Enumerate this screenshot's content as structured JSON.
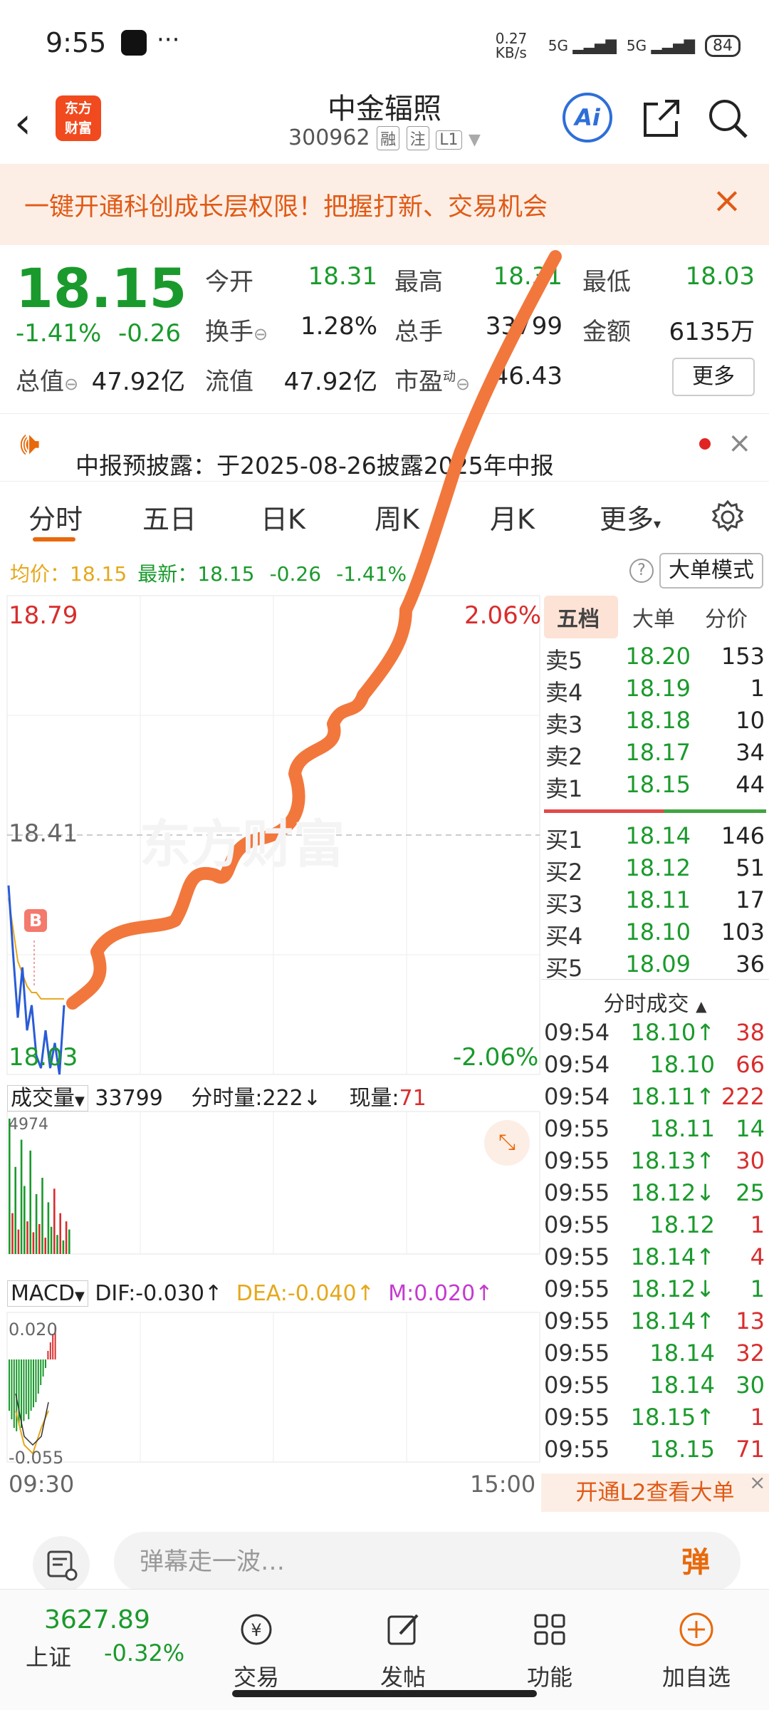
{
  "status_bar": {
    "time": "9:55",
    "speed": "0.27 KB/s",
    "net1": "5G",
    "net2": "5G",
    "battery": "84"
  },
  "header": {
    "logo_line1": "东方",
    "logo_line2": "财富",
    "name": "中金辐照",
    "code": "300962",
    "tags": [
      "融",
      "注",
      "L1"
    ]
  },
  "banner": {
    "text": "一键开通科创成长层权限！把握打新、交易机会"
  },
  "quote": {
    "price": "18.15",
    "pct": "-1.41%",
    "chg": "-0.26",
    "open_label": "今开",
    "open": "18.31",
    "high_label": "最高",
    "high": "18.31",
    "low_label": "最低",
    "low": "18.03",
    "turnover_label": "换手",
    "turnover": "1.28%",
    "volume_label": "总手",
    "volume": "33799",
    "amount_label": "金额",
    "amount": "6135万",
    "mcap_label": "总值",
    "mcap": "47.92亿",
    "float_label": "流值",
    "float": "47.92亿",
    "pe_label": "市盈",
    "pe_sup": "动",
    "pe": "46.43",
    "more": "更多"
  },
  "notice": {
    "text": "中报预披露：于2025-08-26披露2025年中报"
  },
  "tabs": [
    "分时",
    "五日",
    "日K",
    "周K",
    "月K",
    "更多"
  ],
  "avg_row": {
    "avg_label": "均价：",
    "avg": "18.15",
    "last_label": "最新：",
    "last": "18.15",
    "chg": "-0.26",
    "pct": "-1.41%",
    "big_order": "大单模式"
  },
  "chart_data": {
    "type": "line",
    "price_axis": {
      "top": "18.79",
      "mid": "18.41",
      "bottom": "18.03",
      "top_pct": "2.06%",
      "bottom_pct": "-2.06%"
    },
    "marker": "B",
    "price_line": [
      18.33,
      18.22,
      18.12,
      18.2,
      18.1,
      18.14,
      18.06,
      18.04,
      18.1,
      18.04,
      18.08,
      18.03,
      18.14
    ],
    "avg_line": [
      18.31,
      18.26,
      18.21,
      18.19,
      18.17,
      18.16,
      18.16,
      18.15,
      18.15,
      18.15,
      18.15,
      18.15,
      18.15
    ],
    "volume_header": {
      "label": "成交量",
      "value": "33799",
      "minute_label": "分时量:",
      "minute": "222",
      "now_label": "现量:",
      "now": "71"
    },
    "volume_max": "4974",
    "volume_bars": [
      4974,
      1500,
      3200,
      900,
      4200,
      2500,
      1200,
      3800,
      800,
      2200,
      1100,
      2800,
      600,
      1900,
      1000,
      2400,
      700,
      1500,
      500,
      1200,
      900
    ],
    "volume_colors": [
      "g",
      "r",
      "g",
      "r",
      "g",
      "g",
      "r",
      "g",
      "r",
      "g",
      "r",
      "g",
      "r",
      "g",
      "g",
      "r",
      "g",
      "r",
      "g",
      "r",
      "g"
    ],
    "macd_header": {
      "label": "MACD",
      "dif": "DIF:-0.030",
      "dea": "DEA:-0.040",
      "m": "M:0.020"
    },
    "macd_top": "0.020",
    "macd_bottom": "-0.055",
    "macd_bars": [
      -0.03,
      -0.035,
      -0.04,
      -0.042,
      -0.038,
      -0.04,
      -0.036,
      -0.032,
      -0.035,
      -0.03,
      -0.028,
      -0.025,
      -0.02,
      -0.015,
      -0.01,
      -0.005,
      0.005,
      0.01,
      0.015,
      0.02
    ],
    "time_start": "09:30",
    "time_end": "15:00",
    "watermark": "东方财富"
  },
  "order_book": {
    "tabs": [
      "五档",
      "大单",
      "分价"
    ],
    "asks": [
      {
        "label": "卖5",
        "price": "18.20",
        "vol": "153"
      },
      {
        "label": "卖4",
        "price": "18.19",
        "vol": "1"
      },
      {
        "label": "卖3",
        "price": "18.18",
        "vol": "10"
      },
      {
        "label": "卖2",
        "price": "18.17",
        "vol": "34"
      },
      {
        "label": "卖1",
        "price": "18.15",
        "vol": "44"
      }
    ],
    "bids": [
      {
        "label": "买1",
        "price": "18.14",
        "vol": "146"
      },
      {
        "label": "买2",
        "price": "18.12",
        "vol": "51"
      },
      {
        "label": "买3",
        "price": "18.11",
        "vol": "17"
      },
      {
        "label": "买4",
        "price": "18.10",
        "vol": "103"
      },
      {
        "label": "买5",
        "price": "18.09",
        "vol": "36"
      }
    ],
    "trades_title": "分时成交",
    "trades": [
      {
        "t": "09:54",
        "p": "18.10↑",
        "v": "38",
        "c": "red"
      },
      {
        "t": "09:54",
        "p": "18.10",
        "v": "66",
        "c": "red"
      },
      {
        "t": "09:54",
        "p": "18.11↑",
        "v": "222",
        "c": "red"
      },
      {
        "t": "09:55",
        "p": "18.11",
        "v": "14",
        "c": "green"
      },
      {
        "t": "09:55",
        "p": "18.13↑",
        "v": "30",
        "c": "red"
      },
      {
        "t": "09:55",
        "p": "18.12↓",
        "v": "25",
        "c": "green"
      },
      {
        "t": "09:55",
        "p": "18.12",
        "v": "1",
        "c": "red"
      },
      {
        "t": "09:55",
        "p": "18.14↑",
        "v": "4",
        "c": "red"
      },
      {
        "t": "09:55",
        "p": "18.12↓",
        "v": "1",
        "c": "green"
      },
      {
        "t": "09:55",
        "p": "18.14↑",
        "v": "13",
        "c": "red"
      },
      {
        "t": "09:55",
        "p": "18.14",
        "v": "32",
        "c": "red"
      },
      {
        "t": "09:55",
        "p": "18.14",
        "v": "30",
        "c": "green"
      },
      {
        "t": "09:55",
        "p": "18.15↑",
        "v": "1",
        "c": "red"
      },
      {
        "t": "09:55",
        "p": "18.15",
        "v": "71",
        "c": "red"
      }
    ],
    "l2": "开通L2查看大单"
  },
  "comment": {
    "placeholder": "弹幕走一波…",
    "danmaku": "弹"
  },
  "bottom_nav": {
    "index_value": "3627.89",
    "index_name": "上证",
    "index_chg": "-0.32%",
    "items": [
      "交易",
      "发帖",
      "功能",
      "加自选"
    ]
  },
  "colors": {
    "up": "#d92d2d",
    "down": "#1a9a2c",
    "accent": "#e8690b",
    "scribble": "#f2773c"
  }
}
